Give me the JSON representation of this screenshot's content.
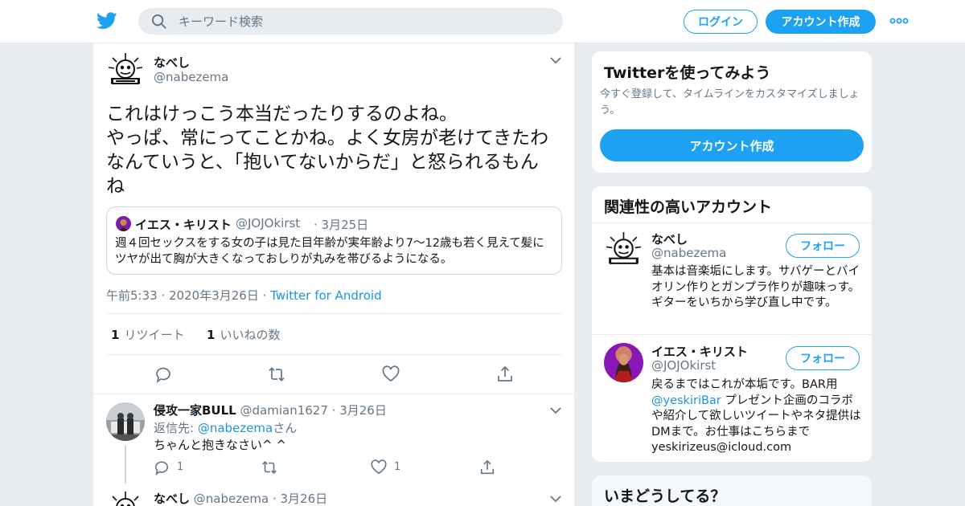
{
  "header": {
    "search_placeholder": "キーワード検索",
    "login_label": "ログイン",
    "signup_label": "アカウント作成",
    "brand_color": "#1da1f2"
  },
  "tweet": {
    "name": "なべし",
    "handle": "@nabezema",
    "text": "これはけっこう本当だったりするのよね。\nやっぱ、常にってことかね。よく女房が老けてきたわなんていうと、「抱いてないからだ」と怒られるもんね",
    "quote": {
      "name": "イエス・キリスト",
      "handle": "@JOJOkirst",
      "date": "3月25日",
      "text": "週４回セックスをする女の子は見た目年齢が実年齢より7～12歳も若く見えて髪にツヤが出て胸が大きくなっておしりが丸みを帯びるようになる。"
    },
    "time": "午前5:33",
    "date": "2020年3月26日",
    "source": "Twitter for Android",
    "retweet_count": "1",
    "retweet_label": "リツイート",
    "like_count": "1",
    "like_label": "いいねの数"
  },
  "replies": [
    {
      "name": "侵攻一家BULL",
      "handle": "@damian1627",
      "date": "3月26日",
      "reply_prefix": "返信先: ",
      "reply_to": "@nabezema",
      "reply_suffix": "さん",
      "text": "ちゃんと抱きなさい^ ^",
      "reply_count": "1",
      "like_count": "1"
    },
    {
      "name": "なべし",
      "handle": "@nabezema",
      "date": "3月26日"
    }
  ],
  "sidebar": {
    "try_title": "Twitterを使ってみよう",
    "try_sub": "今すぐ登録して、タイムラインをカスタマイズしましょう。",
    "try_button": "アカウント作成",
    "related_title": "関連性の高いアカウント",
    "follow_label": "フォロー",
    "accounts": [
      {
        "name": "なべし",
        "handle": "@nabezema",
        "bio": "基本は音楽垢にします。サバゲーとバイオリン作りとガンプラ作りが趣味っす。 ギターをいちから学び直し中です。"
      },
      {
        "name": "イエス・キリスト",
        "handle": "@JOJOkirst",
        "bio_1": "戻るまではこれが本垢です。BAR用",
        "bio_link": "@yeskiriBar",
        "bio_2": " プレゼント企画のコラボや紹介して欲しいツイートやネタ提供はDMまで。お仕事はこちらまで yeskirizeus@icloud.com"
      }
    ],
    "trends_title": "いまどうしてる？"
  }
}
